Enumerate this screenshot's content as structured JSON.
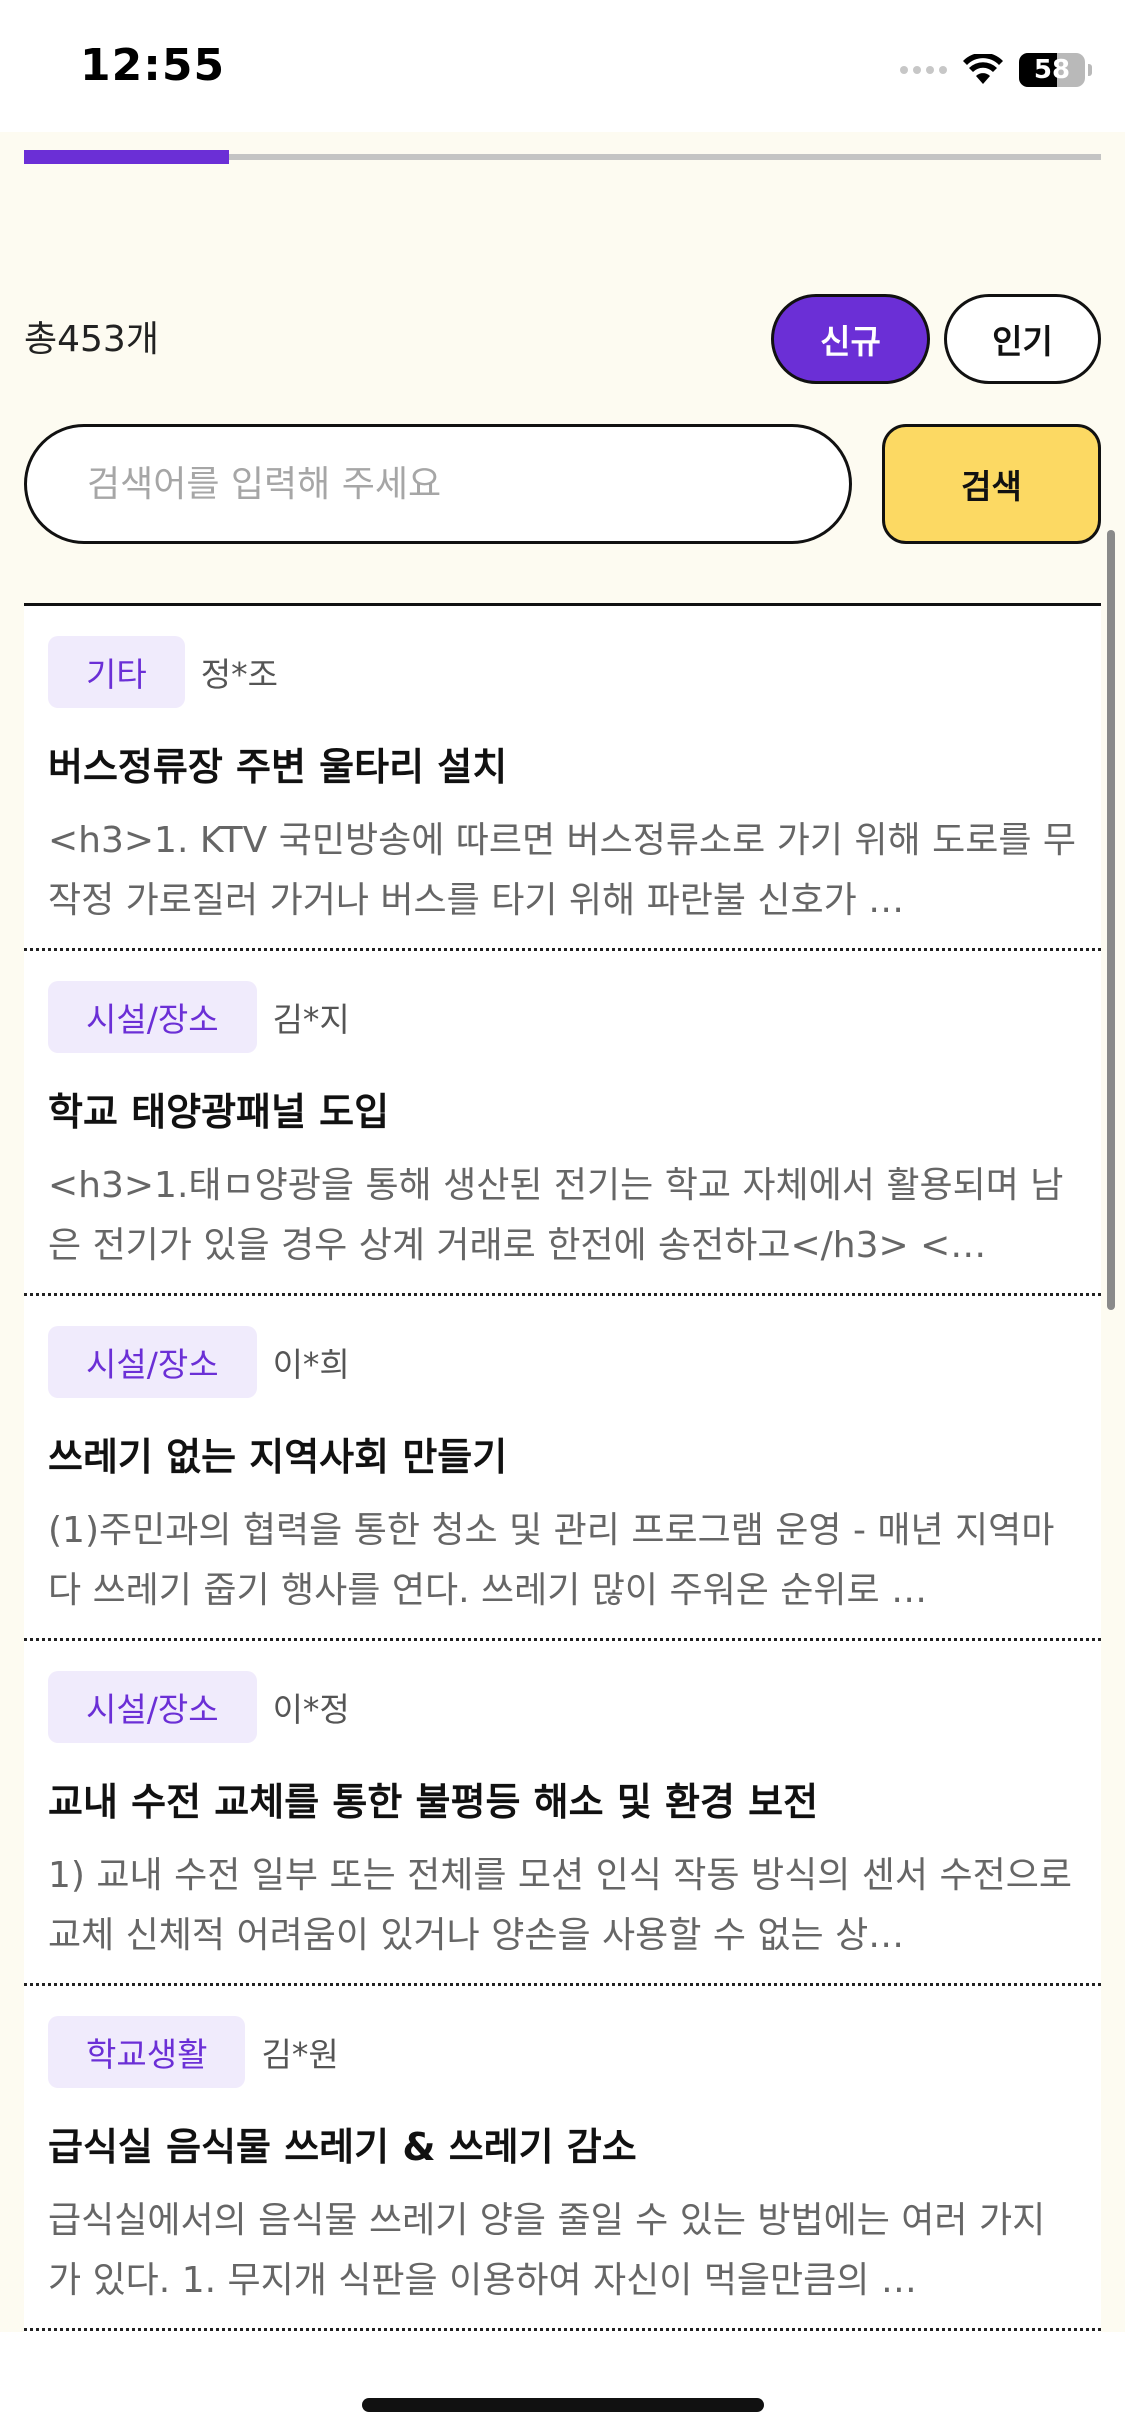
{
  "status_bar": {
    "time": "12:55",
    "battery": "58",
    "icons": [
      "cellular-signal-icon",
      "wifi-icon",
      "battery-icon"
    ]
  },
  "progress": {
    "value": 0.19
  },
  "total_count": "총453개",
  "sort": {
    "new_label": "신규",
    "popular_label": "인기",
    "active": "신규"
  },
  "search": {
    "placeholder": "검색어를 입력해 주세요",
    "button_label": "검색"
  },
  "colors": {
    "accent": "#6b2fd6",
    "search_button": "#fcd963",
    "background": "#fdfbf1",
    "category_bg": "#f0ebfc"
  },
  "items": [
    {
      "category": "기타",
      "author": "정*조",
      "title": "버스정류장 주변 울타리 설치",
      "description": "<h3>1. KTV 국민방송에 따르면 버스정류소로 가기 위해 도로를 무작정 가로질러 가거나 버스를 타기 위해 파란불 신호가 …"
    },
    {
      "category": "시설/장소",
      "author": "김*지",
      "title": "학교 태양광패널 도입",
      "description": "<h3>1.태ㅁ양광을 통해 생산된 전기는 학교 자체에서 활용되며 남은 전기가 있을 경우 상계 거래로 한전에 송전하고</h3> <…"
    },
    {
      "category": "시설/장소",
      "author": "이*희",
      "title": "쓰레기 없는 지역사회 만들기",
      "description": "(1)주민과의 협력을 통한 청소 및 관리 프로그램 운영 - 매년 지역마다 쓰레기 줍기 행사를 연다. 쓰레기 많이 주워온 순위로 …"
    },
    {
      "category": "시설/장소",
      "author": "이*정",
      "title": "교내 수전 교체를 통한 불평등 해소 및 환경 보전",
      "description": "1) 교내 수전 일부 또는 전체를 모션 인식 작동 방식의 센서 수전으로 교체 신체적 어려움이 있거나 양손을 사용할 수 없는 상…"
    },
    {
      "category": "학교생활",
      "author": "김*원",
      "title": "급식실 음식물 쓰레기 & 쓰레기 감소",
      "description": "급식실에서의 음식물 쓰레기 양을 줄일 수 있는 방법에는 여러 가지가 있다. 1. 무지개 식판을 이용하여 자신이 먹을만큼의 …"
    }
  ]
}
